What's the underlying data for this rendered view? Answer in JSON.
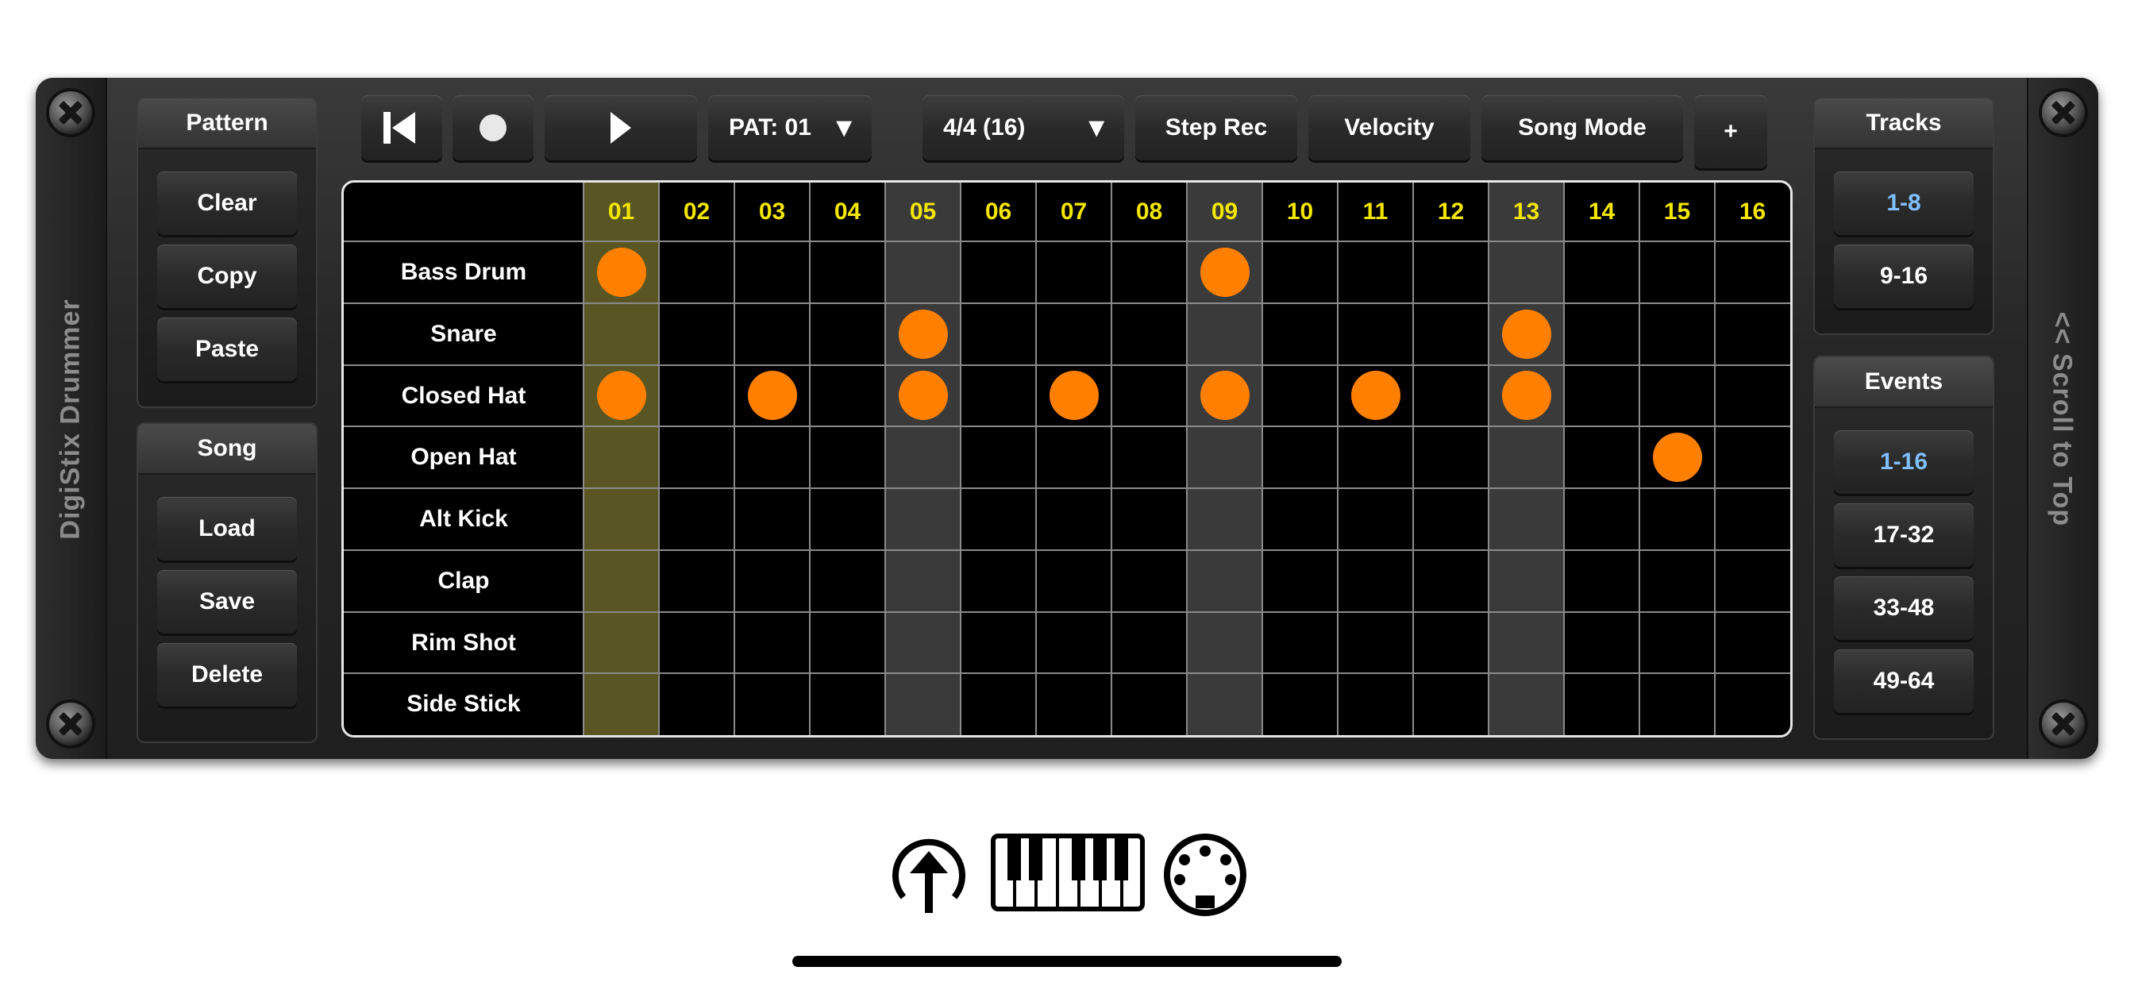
{
  "app_title": "DigiStix Drummer",
  "scroll_label": "<< Scroll to Top",
  "pattern_panel": {
    "title": "Pattern",
    "buttons": [
      "Clear",
      "Copy",
      "Paste"
    ]
  },
  "song_panel": {
    "title": "Song",
    "buttons": [
      "Load",
      "Save",
      "Delete"
    ]
  },
  "tracks_panel": {
    "title": "Tracks",
    "buttons": [
      "1-8",
      "9-16"
    ],
    "selected": 0
  },
  "events_panel": {
    "title": "Events",
    "buttons": [
      "1-16",
      "17-32",
      "33-48",
      "49-64"
    ],
    "selected": 0
  },
  "toolbar": {
    "pattern_select": "PAT: 01",
    "time_signature": "4/4 (16)",
    "step_rec": "Step Rec",
    "velocity": "Velocity",
    "song_mode": "Song Mode",
    "plus": "+",
    "dropdown_glyph": "▼"
  },
  "icons": {
    "rewind": "rewind-to-start-icon",
    "record": "record-icon",
    "play": "play-icon",
    "upload": "upload-icon",
    "keyboard": "piano-keyboard-icon",
    "midi": "midi-port-icon"
  },
  "grid": {
    "steps": [
      "01",
      "02",
      "03",
      "04",
      "05",
      "06",
      "07",
      "08",
      "09",
      "10",
      "11",
      "12",
      "13",
      "14",
      "15",
      "16"
    ],
    "current_step": 1,
    "accent_steps": [
      5,
      9,
      13
    ],
    "tracks": [
      {
        "name": "Bass Drum",
        "hits": [
          1,
          9
        ]
      },
      {
        "name": "Snare",
        "hits": [
          5,
          13
        ]
      },
      {
        "name": "Closed Hat",
        "hits": [
          1,
          3,
          5,
          7,
          9,
          11,
          13
        ]
      },
      {
        "name": "Open Hat",
        "hits": [
          15
        ]
      },
      {
        "name": "Alt Kick",
        "hits": []
      },
      {
        "name": "Clap",
        "hits": []
      },
      {
        "name": "Rim Shot",
        "hits": []
      },
      {
        "name": "Side Stick",
        "hits": []
      }
    ]
  },
  "colors": {
    "note": "#ff8000",
    "step_label": "#f2e600",
    "current_step_col": "#5a5623",
    "accent_col": "#3a3a3a",
    "selected_text": "#7fbfff"
  }
}
